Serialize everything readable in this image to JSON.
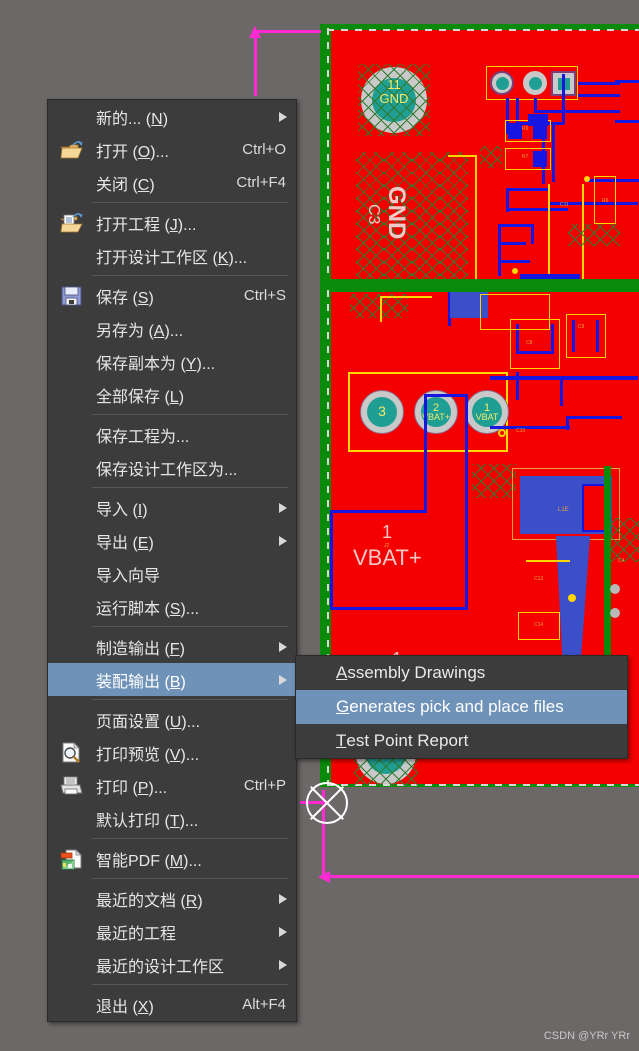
{
  "app": {
    "background_color": "#6b6867",
    "menu_bg": "#3c3c3c",
    "menu_highlight": "#6f92b8",
    "pcb_red": "#f50000",
    "pcb_green": "#0a8a0a",
    "trace_blue": "#1616e0",
    "trace_yellow": "#ffd700",
    "dimension_magenta": "#ff2ad4"
  },
  "watermark": {
    "text": "CSDN @YRr YRr"
  },
  "file_menu": {
    "name": "file-menu",
    "items": [
      {
        "id": "new",
        "label": "新的... (N)",
        "mnemonic": "N",
        "accel": "",
        "icon": "",
        "submenu": true,
        "separator_after": false,
        "highlight": false
      },
      {
        "id": "open",
        "label": "打开 (O)...",
        "mnemonic": "O",
        "accel": "Ctrl+O",
        "icon": "open-folder-icon",
        "submenu": false,
        "separator_after": false,
        "highlight": false
      },
      {
        "id": "close",
        "label": "关闭 (C)",
        "mnemonic": "C",
        "accel": "Ctrl+F4",
        "icon": "",
        "submenu": false,
        "separator_after": true,
        "highlight": false
      },
      {
        "id": "open-project",
        "label": "打开工程 (J)...",
        "mnemonic": "J",
        "accel": "",
        "icon": "open-project-icon",
        "submenu": false,
        "separator_after": false,
        "highlight": false
      },
      {
        "id": "open-workspace",
        "label": "打开设计工作区 (K)...",
        "mnemonic": "K",
        "accel": "",
        "icon": "",
        "submenu": false,
        "separator_after": true,
        "highlight": false
      },
      {
        "id": "save",
        "label": "保存 (S)",
        "mnemonic": "S",
        "accel": "Ctrl+S",
        "icon": "save-floppy-icon",
        "submenu": false,
        "separator_after": false,
        "highlight": false
      },
      {
        "id": "save-as",
        "label": "另存为 (A)...",
        "mnemonic": "A",
        "accel": "",
        "icon": "",
        "submenu": false,
        "separator_after": false,
        "highlight": false
      },
      {
        "id": "save-copy-as",
        "label": "保存副本为 (Y)...",
        "mnemonic": "Y",
        "accel": "",
        "icon": "",
        "submenu": false,
        "separator_after": false,
        "highlight": false
      },
      {
        "id": "save-all",
        "label": "全部保存 (L)",
        "mnemonic": "L",
        "accel": "",
        "icon": "",
        "submenu": false,
        "separator_after": true,
        "highlight": false
      },
      {
        "id": "save-project-as",
        "label": "保存工程为...",
        "mnemonic": "",
        "accel": "",
        "icon": "",
        "submenu": false,
        "separator_after": false,
        "highlight": false
      },
      {
        "id": "save-workspace-as",
        "label": "保存设计工作区为...",
        "mnemonic": "",
        "accel": "",
        "icon": "",
        "submenu": false,
        "separator_after": true,
        "highlight": false
      },
      {
        "id": "import",
        "label": "导入 (I)",
        "mnemonic": "I",
        "accel": "",
        "icon": "",
        "submenu": true,
        "separator_after": false,
        "highlight": false
      },
      {
        "id": "export",
        "label": "导出 (E)",
        "mnemonic": "E",
        "accel": "",
        "icon": "",
        "submenu": true,
        "separator_after": false,
        "highlight": false
      },
      {
        "id": "import-wizard",
        "label": "导入向导",
        "mnemonic": "",
        "accel": "",
        "icon": "",
        "submenu": false,
        "separator_after": false,
        "highlight": false
      },
      {
        "id": "run-script",
        "label": "运行脚本 (S)...",
        "mnemonic": "S",
        "accel": "",
        "icon": "",
        "submenu": false,
        "separator_after": true,
        "highlight": false
      },
      {
        "id": "fabrication-outputs",
        "label": "制造输出 (F)",
        "mnemonic": "F",
        "accel": "",
        "icon": "",
        "submenu": true,
        "separator_after": false,
        "highlight": false
      },
      {
        "id": "assembly-outputs",
        "label": "装配输出 (B)",
        "mnemonic": "B",
        "accel": "",
        "icon": "",
        "submenu": true,
        "separator_after": true,
        "highlight": true
      },
      {
        "id": "page-setup",
        "label": "页面设置 (U)...",
        "mnemonic": "U",
        "accel": "",
        "icon": "",
        "submenu": false,
        "separator_after": false,
        "highlight": false
      },
      {
        "id": "print-preview",
        "label": "打印预览 (V)...",
        "mnemonic": "V",
        "accel": "",
        "icon": "print-preview-icon",
        "submenu": false,
        "separator_after": false,
        "highlight": false
      },
      {
        "id": "print",
        "label": "打印 (P)...",
        "mnemonic": "P",
        "accel": "Ctrl+P",
        "icon": "printer-icon",
        "submenu": false,
        "separator_after": false,
        "highlight": false
      },
      {
        "id": "default-print",
        "label": "默认打印 (T)...",
        "mnemonic": "T",
        "accel": "",
        "icon": "",
        "submenu": false,
        "separator_after": true,
        "highlight": false
      },
      {
        "id": "smart-pdf",
        "label": "智能PDF (M)...",
        "mnemonic": "M",
        "accel": "",
        "icon": "smart-pdf-icon",
        "submenu": false,
        "separator_after": true,
        "highlight": false
      },
      {
        "id": "recent-documents",
        "label": "最近的文档 (R)",
        "mnemonic": "R",
        "accel": "",
        "icon": "",
        "submenu": true,
        "separator_after": false,
        "highlight": false
      },
      {
        "id": "recent-projects",
        "label": "最近的工程",
        "mnemonic": "",
        "accel": "",
        "icon": "",
        "submenu": true,
        "separator_after": false,
        "highlight": false
      },
      {
        "id": "recent-workspaces",
        "label": "最近的设计工作区",
        "mnemonic": "",
        "accel": "",
        "icon": "",
        "submenu": true,
        "separator_after": true,
        "highlight": false
      },
      {
        "id": "exit",
        "label": "退出 (X)",
        "mnemonic": "X",
        "accel": "Alt+F4",
        "icon": "",
        "submenu": false,
        "separator_after": false,
        "highlight": false
      }
    ]
  },
  "assembly_submenu": {
    "name": "assembly-outputs-submenu",
    "items": [
      {
        "id": "assembly-drawings",
        "first": "A",
        "rest": "ssembly Drawings",
        "highlight": false
      },
      {
        "id": "pick-and-place",
        "first": "G",
        "rest": "enerates pick and place files",
        "highlight": true
      },
      {
        "id": "test-point-report",
        "first": "T",
        "rest": "est Point Report",
        "highlight": false
      }
    ]
  },
  "pcb": {
    "name": "pcb-editor-canvas",
    "pads": [
      {
        "id": "pad-3",
        "number": "3",
        "net": ""
      },
      {
        "id": "pad-2",
        "number": "2",
        "net": "VBAT+"
      },
      {
        "id": "pad-1",
        "number": "1",
        "net": "VBAT"
      }
    ],
    "silkscreen": [
      {
        "id": "gnd-pad-11",
        "line1": "11",
        "line2": "GND"
      },
      {
        "id": "gnd-text",
        "text": "GND"
      },
      {
        "id": "c3-text",
        "text": "C3"
      },
      {
        "id": "vbat-num",
        "text": "1"
      },
      {
        "id": "vbat-text",
        "text": "VBAT+"
      },
      {
        "id": "one-text",
        "text": "1"
      }
    ],
    "designators": [
      "R9",
      "R7",
      "C11",
      "C12",
      "R6",
      "C8",
      "C9",
      "C10",
      "L1",
      "C4",
      "L1E",
      "C14",
      "C13",
      "C16",
      "C5"
    ]
  }
}
